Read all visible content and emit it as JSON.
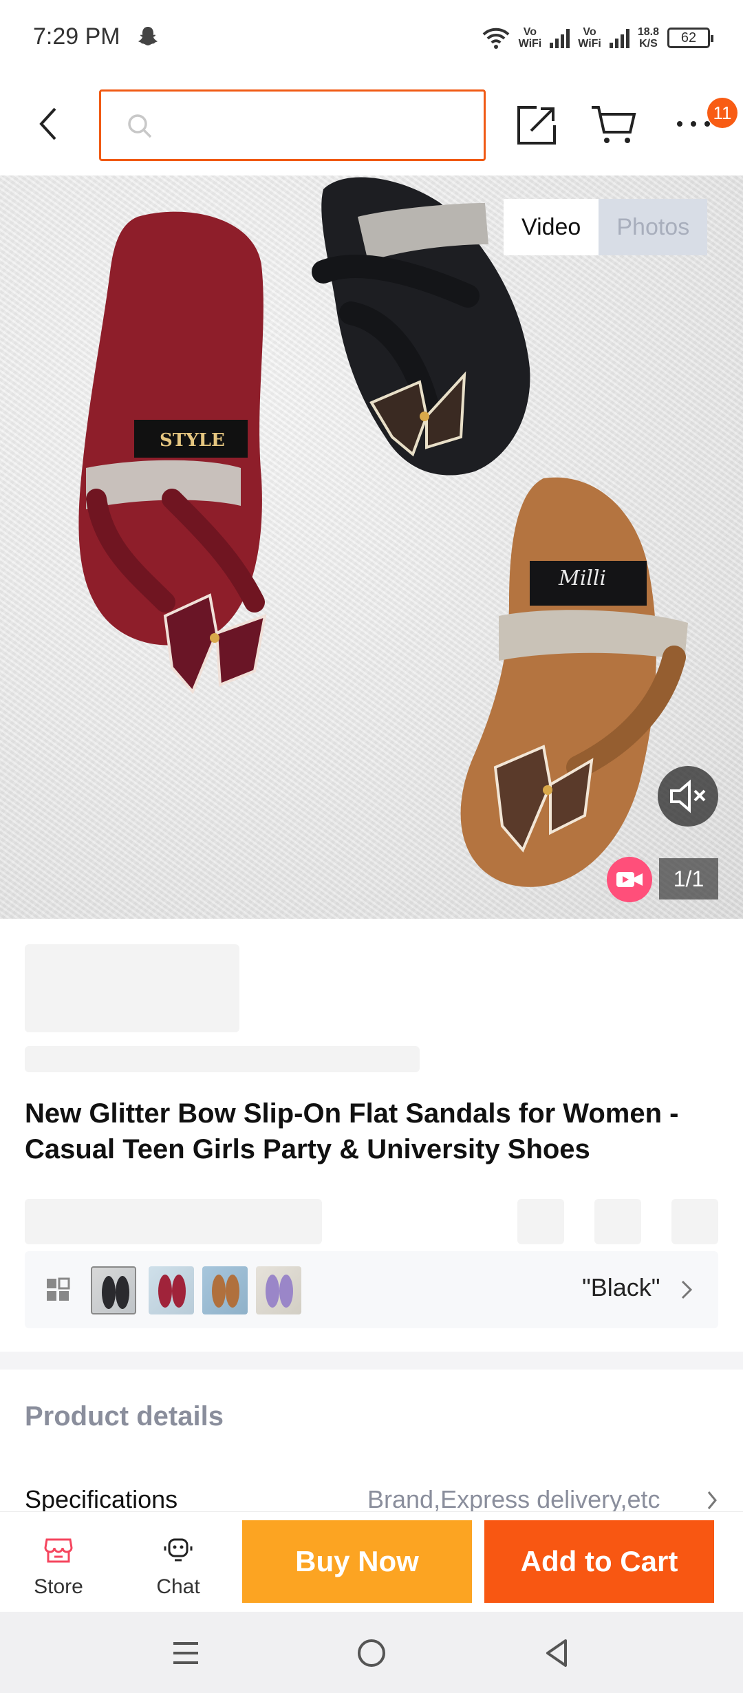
{
  "status_bar": {
    "time": "7:29 PM",
    "vo_wifi_1": "Vo\nWiFi",
    "vo_wifi_2": "Vo\nWiFi",
    "net_speed": "18.8\nK/S",
    "battery": "62"
  },
  "header": {
    "search_placeholder": "",
    "cart_count": "11",
    "icons": [
      "chevron-left-icon",
      "search-icon",
      "share-icon",
      "cart-icon",
      "more-icon"
    ]
  },
  "media": {
    "tabs": [
      {
        "label": "Video",
        "active": true
      },
      {
        "label": "Photos",
        "active": false
      }
    ],
    "counter": "1/1",
    "accent": "#ff4f7a"
  },
  "product": {
    "title": "New Glitter Bow Slip-On Flat Sandals for Women - Casual Teen Girls Party & University Shoes",
    "selected_variant": "\"Black\"",
    "variant_colors": [
      "#2a2a2e",
      "#a0233a",
      "#b0703d",
      "#9a86c8"
    ]
  },
  "details": {
    "heading": "Product details",
    "spec_label": "Specifications",
    "spec_value": "Brand,Express delivery,etc"
  },
  "bottom_bar": {
    "store_label": "Store",
    "chat_label": "Chat",
    "buy_now": "Buy Now",
    "add_to_cart": "Add to Cart",
    "buy_color": "#fca422",
    "cart_color": "#f85712"
  }
}
